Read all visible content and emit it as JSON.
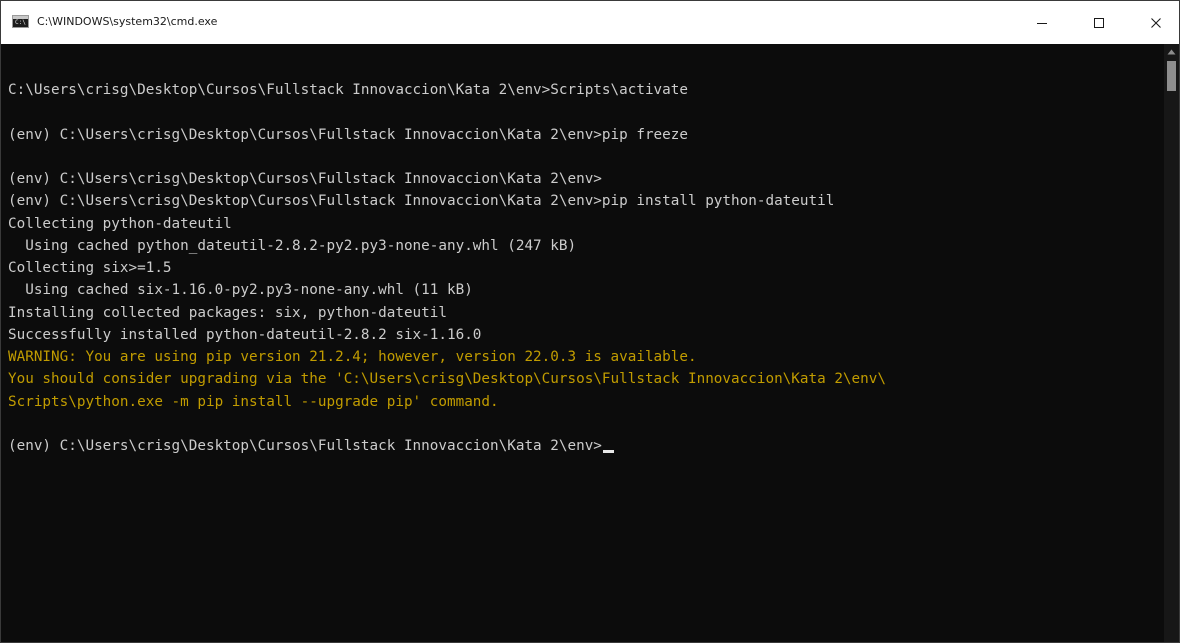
{
  "window": {
    "title": "C:\\WINDOWS\\system32\\cmd.exe",
    "app_icon": "cmd-icon",
    "controls": {
      "minimize_icon": "minimize-icon",
      "maximize_icon": "maximize-icon",
      "close_icon": "close-icon"
    }
  },
  "console": {
    "lines": [
      {
        "text": "C:\\Users\\crisg\\Desktop\\Cursos\\Fullstack Innovaccion\\Kata 2\\env>Scripts\\activate",
        "style": "normal"
      },
      {
        "text": "",
        "style": "normal"
      },
      {
        "text": "(env) C:\\Users\\crisg\\Desktop\\Cursos\\Fullstack Innovaccion\\Kata 2\\env>pip freeze",
        "style": "normal"
      },
      {
        "text": "",
        "style": "normal"
      },
      {
        "text": "(env) C:\\Users\\crisg\\Desktop\\Cursos\\Fullstack Innovaccion\\Kata 2\\env>",
        "style": "normal"
      },
      {
        "text": "(env) C:\\Users\\crisg\\Desktop\\Cursos\\Fullstack Innovaccion\\Kata 2\\env>pip install python-dateutil",
        "style": "normal"
      },
      {
        "text": "Collecting python-dateutil",
        "style": "normal"
      },
      {
        "text": "  Using cached python_dateutil-2.8.2-py2.py3-none-any.whl (247 kB)",
        "style": "normal"
      },
      {
        "text": "Collecting six>=1.5",
        "style": "normal"
      },
      {
        "text": "  Using cached six-1.16.0-py2.py3-none-any.whl (11 kB)",
        "style": "normal"
      },
      {
        "text": "Installing collected packages: six, python-dateutil",
        "style": "normal"
      },
      {
        "text": "Successfully installed python-dateutil-2.8.2 six-1.16.0",
        "style": "normal"
      },
      {
        "text": "WARNING: You are using pip version 21.2.4; however, version 22.0.3 is available.",
        "style": "warn"
      },
      {
        "text": "You should consider upgrading via the 'C:\\Users\\crisg\\Desktop\\Cursos\\Fullstack Innovaccion\\Kata 2\\env\\",
        "style": "warn"
      },
      {
        "text": "Scripts\\python.exe -m pip install --upgrade pip' command.",
        "style": "warn"
      },
      {
        "text": "",
        "style": "normal"
      },
      {
        "text": "(env) C:\\Users\\crisg\\Desktop\\Cursos\\Fullstack Innovaccion\\Kata 2\\env>",
        "style": "normal",
        "cursor": true
      }
    ]
  },
  "colors": {
    "console_background": "#0c0c0c",
    "console_text": "#cccccc",
    "warning_text": "#c19c00",
    "titlebar_background": "#ffffff"
  },
  "scrollbar": {
    "up_arrow_icon": "scroll-up-arrow-icon"
  }
}
